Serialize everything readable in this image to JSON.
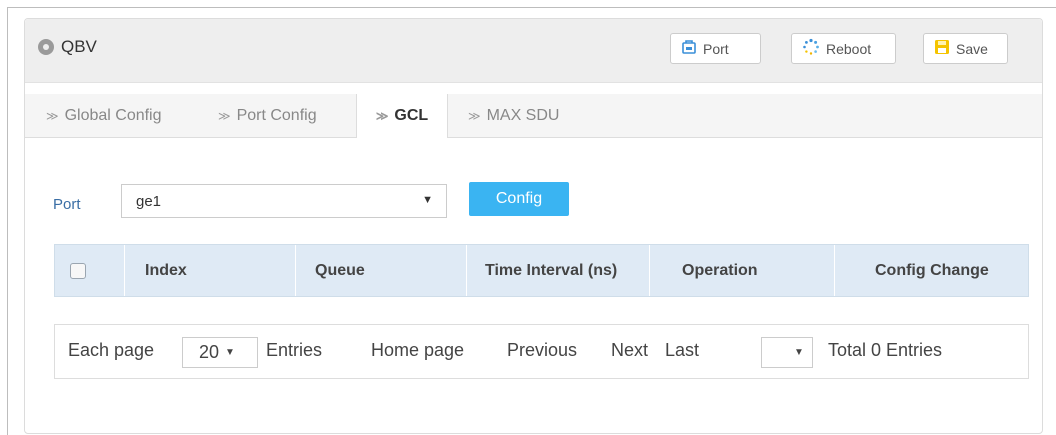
{
  "header": {
    "title": "QBV",
    "buttons": {
      "port": "Port",
      "reboot": "Reboot",
      "save": "Save"
    }
  },
  "tabs": [
    {
      "label": "Global Config",
      "active": false
    },
    {
      "label": "Port Config",
      "active": false
    },
    {
      "label": "GCL",
      "active": true
    },
    {
      "label": "MAX SDU",
      "active": false
    }
  ],
  "form": {
    "port_label": "Port",
    "port_value": "ge1",
    "config_button": "Config"
  },
  "table": {
    "columns": [
      "Index",
      "Queue",
      "Time Interval (ns)",
      "Operation",
      "Config Change"
    ],
    "rows": []
  },
  "pager": {
    "each_page": "Each page",
    "page_size": "20",
    "entries": "Entries",
    "home": "Home page",
    "previous": "Previous",
    "next": "Next",
    "last": "Last",
    "page_value": "",
    "total": "Total 0 Entries"
  },
  "colors": {
    "accent": "#3ab4f2",
    "header_bg": "#eeeeee",
    "table_header_bg": "#dfeaf5",
    "label_blue": "#3a6ea5",
    "save_icon": "#f5c400"
  }
}
